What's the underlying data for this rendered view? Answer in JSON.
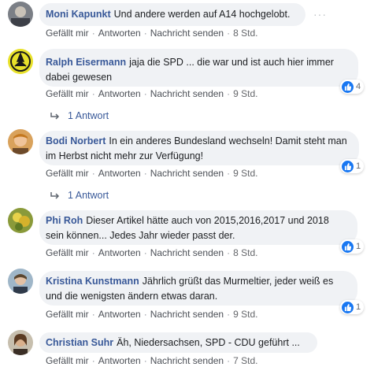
{
  "actions": {
    "like": "Gefällt mir",
    "reply": "Antworten",
    "message": "Nachricht senden",
    "separator": "·"
  },
  "comments": [
    {
      "author": "Moni Kapunkt",
      "text": "Und andere werden auf A14 hochgelobt.",
      "time": "8 Std.",
      "more": "···"
    },
    {
      "author": "Ralph Eisermann",
      "text": "jaja die SPD ... die war und ist auch hier immer dabei gewesen",
      "time": "9 Std.",
      "reactions": "4",
      "replies": "1 Antwort"
    },
    {
      "author": "Bodi Norbert",
      "text": "In ein anderes Bundesland wechseln! Damit steht man im Herbst nicht mehr zur Verfügung!",
      "time": "9 Std.",
      "reactions": "1",
      "replies": "1 Antwort"
    },
    {
      "author": "Phi Roh",
      "text": "Dieser Artikel hätte auch von 2015,2016,2017 und 2018 sein können... Jedes Jahr wieder passt der.",
      "time": "8 Std.",
      "reactions": "1"
    },
    {
      "author": "Kristina Kunstmann",
      "text": "Jährlich grüßt das Murmeltier, jeder weiß es und die wenigsten ändern etwas daran.",
      "time": "9 Std.",
      "reactions": "1"
    },
    {
      "author": "Christian Suhr",
      "text": "Äh, Niedersachsen, SPD - CDU geführt ...",
      "time": "7 Std."
    }
  ],
  "icons": {
    "like_icon": "thumbs-up-icon",
    "reply_arrow": "reply-arrow-icon",
    "more": "more-options-icon"
  },
  "colors": {
    "author": "#385898",
    "bubble": "#f0f2f5",
    "like_badge": "#1877f2"
  }
}
